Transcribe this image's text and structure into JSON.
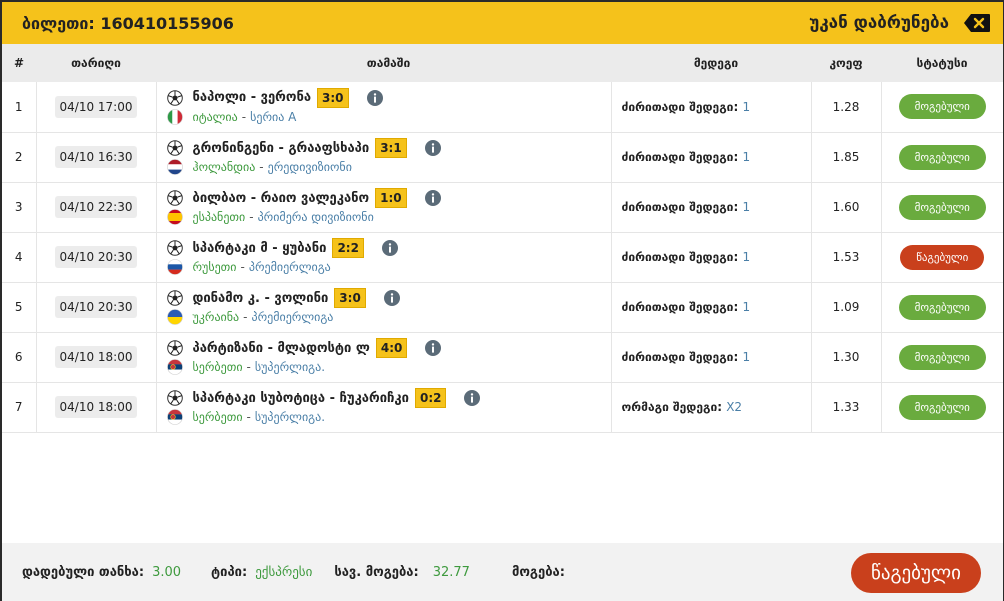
{
  "header": {
    "ticket_label": "ბილეთი: 160410155906",
    "back_label": "უკან დაბრუნება"
  },
  "columns": {
    "num": "#",
    "date": "თარიღი",
    "game": "თამაში",
    "bet": "მედეგი",
    "coef": "კოეფ",
    "status": "სტატუსი"
  },
  "rows": [
    {
      "num": "1",
      "date": "04/10 17:00",
      "teams": "ნაპოლი - ვერონა",
      "score": "3:0",
      "country": "იტალია",
      "league": "სერია A",
      "flag": "italy",
      "bet_label": "ძირითადი შედეგი:",
      "bet_value": "1",
      "coef": "1.28",
      "status": "მოგებული",
      "status_type": "won"
    },
    {
      "num": "2",
      "date": "04/10 16:30",
      "teams": "გრონინგენი - გრააფსხაპი",
      "score": "3:1",
      "country": "ჰოლანდია",
      "league": "ერედივიზიონი",
      "flag": "netherlands",
      "bet_label": "ძირითადი შედეგი:",
      "bet_value": "1",
      "coef": "1.85",
      "status": "მოგებული",
      "status_type": "won"
    },
    {
      "num": "3",
      "date": "04/10 22:30",
      "teams": "ბილბაო - რაიო ვალეკანო",
      "score": "1:0",
      "country": "ესპანეთი",
      "league": "პრიმერა დივიზიონი",
      "flag": "spain",
      "bet_label": "ძირითადი შედეგი:",
      "bet_value": "1",
      "coef": "1.60",
      "status": "მოგებული",
      "status_type": "won"
    },
    {
      "num": "4",
      "date": "04/10 20:30",
      "teams": "სპარტაკი მ - ყუბანი",
      "score": "2:2",
      "country": "რუსეთი",
      "league": "პრემიერლიგა",
      "flag": "russia",
      "bet_label": "ძირითადი შედეგი:",
      "bet_value": "1",
      "coef": "1.53",
      "status": "წაგებული",
      "status_type": "lost"
    },
    {
      "num": "5",
      "date": "04/10 20:30",
      "teams": "დინამო კ. - ვოლინი",
      "score": "3:0",
      "country": "უკრაინა",
      "league": "პრემიერლიგა",
      "flag": "ukraine",
      "bet_label": "ძირითადი შედეგი:",
      "bet_value": "1",
      "coef": "1.09",
      "status": "მოგებული",
      "status_type": "won"
    },
    {
      "num": "6",
      "date": "04/10 18:00",
      "teams": "პარტიზანი - მლადოსტი ლ",
      "score": "4:0",
      "country": "სერბეთი",
      "league": "სუპერლიგა.",
      "flag": "serbia",
      "bet_label": "ძირითადი შედეგი:",
      "bet_value": "1",
      "coef": "1.30",
      "status": "მოგებული",
      "status_type": "won"
    },
    {
      "num": "7",
      "date": "04/10 18:00",
      "teams": "სპარტაკი სუბოტიცა - ჩუკარიჩკი",
      "score": "0:2",
      "country": "სერბეთი",
      "league": "სუპერლიგა.",
      "flag": "serbia",
      "bet_label": "ორმაგი შედეგი:",
      "bet_value": "X2",
      "coef": "1.33",
      "status": "მოგებული",
      "status_type": "won"
    }
  ],
  "footer": {
    "stake_label": "დადებული თანხა:",
    "stake_value": "3.00",
    "type_label": "ტიპი:",
    "type_value": "ექსპრესი",
    "total_label": "სავ. მოგება:",
    "total_value": "32.77",
    "win_label": "მოგება:",
    "status_label": "წაგებული"
  },
  "colors": {
    "accent": "#f5c21b",
    "won": "#6aab3e",
    "lost": "#c9401c",
    "link": "#4a7fa7",
    "country": "#3e9a3e"
  }
}
